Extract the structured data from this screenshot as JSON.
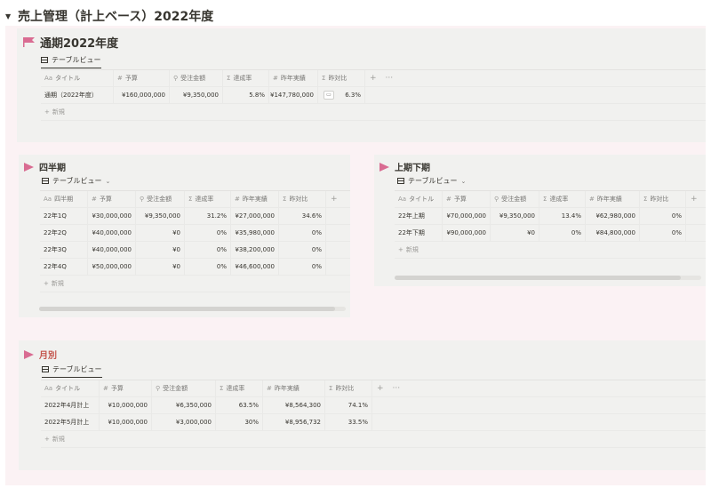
{
  "page": {
    "title": "売上管理（計上ベース）2022年度"
  },
  "colors": {
    "accent": "#d96c92",
    "callout_bg": "#f1f1ef",
    "outer_bg": "#fbf2f4",
    "title_red": "#c4554d"
  },
  "sections": {
    "annual": {
      "title": "通期2022年度",
      "tab": "テーブルビュー",
      "headers": [
        "タイトル",
        "予算",
        "受注金額",
        "達成率",
        "昨年実績",
        "昨対比"
      ],
      "rows": [
        {
          "title": "通期（2022年度）",
          "budget": "¥160,000,000",
          "orders": "¥9,350,000",
          "rate": "5.8%",
          "last": "¥147,780,000",
          "yoy": "6.3%"
        }
      ],
      "new_label": "新規"
    },
    "quarter": {
      "title": "四半期",
      "tab": "テーブルビュー",
      "headers": [
        "四半期",
        "予算",
        "受注金額",
        "達成率",
        "昨年実績",
        "昨対比"
      ],
      "rows": [
        {
          "title": "22年1Q",
          "budget": "¥30,000,000",
          "orders": "¥9,350,000",
          "rate": "31.2%",
          "last": "¥27,000,000",
          "yoy": "34.6%"
        },
        {
          "title": "22年2Q",
          "budget": "¥40,000,000",
          "orders": "¥0",
          "rate": "0%",
          "last": "¥35,980,000",
          "yoy": "0%"
        },
        {
          "title": "22年3Q",
          "budget": "¥40,000,000",
          "orders": "¥0",
          "rate": "0%",
          "last": "¥38,200,000",
          "yoy": "0%"
        },
        {
          "title": "22年4Q",
          "budget": "¥50,000,000",
          "orders": "¥0",
          "rate": "0%",
          "last": "¥46,600,000",
          "yoy": "0%"
        }
      ],
      "new_label": "新規"
    },
    "half": {
      "title": "上期下期",
      "tab": "テーブルビュー",
      "headers": [
        "タイトル",
        "予算",
        "受注金額",
        "達成率",
        "昨年実績",
        "昨対比"
      ],
      "rows": [
        {
          "title": "22年上期",
          "budget": "¥70,000,000",
          "orders": "¥9,350,000",
          "rate": "13.4%",
          "last": "¥62,980,000",
          "yoy": "0%"
        },
        {
          "title": "22年下期",
          "budget": "¥90,000,000",
          "orders": "¥0",
          "rate": "0%",
          "last": "¥84,800,000",
          "yoy": "0%"
        }
      ],
      "new_label": "新規"
    },
    "monthly": {
      "title": "月別",
      "tab": "テーブルビュー",
      "headers": [
        "タイトル",
        "予算",
        "受注金額",
        "達成率",
        "昨年実績",
        "昨対比"
      ],
      "rows": [
        {
          "title": "2022年4月計上",
          "budget": "¥10,000,000",
          "orders": "¥6,350,000",
          "rate": "63.5%",
          "last": "¥8,564,300",
          "yoy": "74.1%"
        },
        {
          "title": "2022年5月計上",
          "budget": "¥10,000,000",
          "orders": "¥3,000,000",
          "rate": "30%",
          "last": "¥8,956,732",
          "yoy": "33.5%"
        }
      ],
      "new_label": "新規"
    }
  },
  "icons": {
    "collapse": "triangle-down-icon",
    "flag": "flag-icon",
    "toggle": "triangle-right-icon",
    "text_prop": "Aa",
    "number_prop": "#",
    "formula_prop": "Σ",
    "rollup_prop": "search-icon",
    "plus": "+",
    "more": "···"
  }
}
